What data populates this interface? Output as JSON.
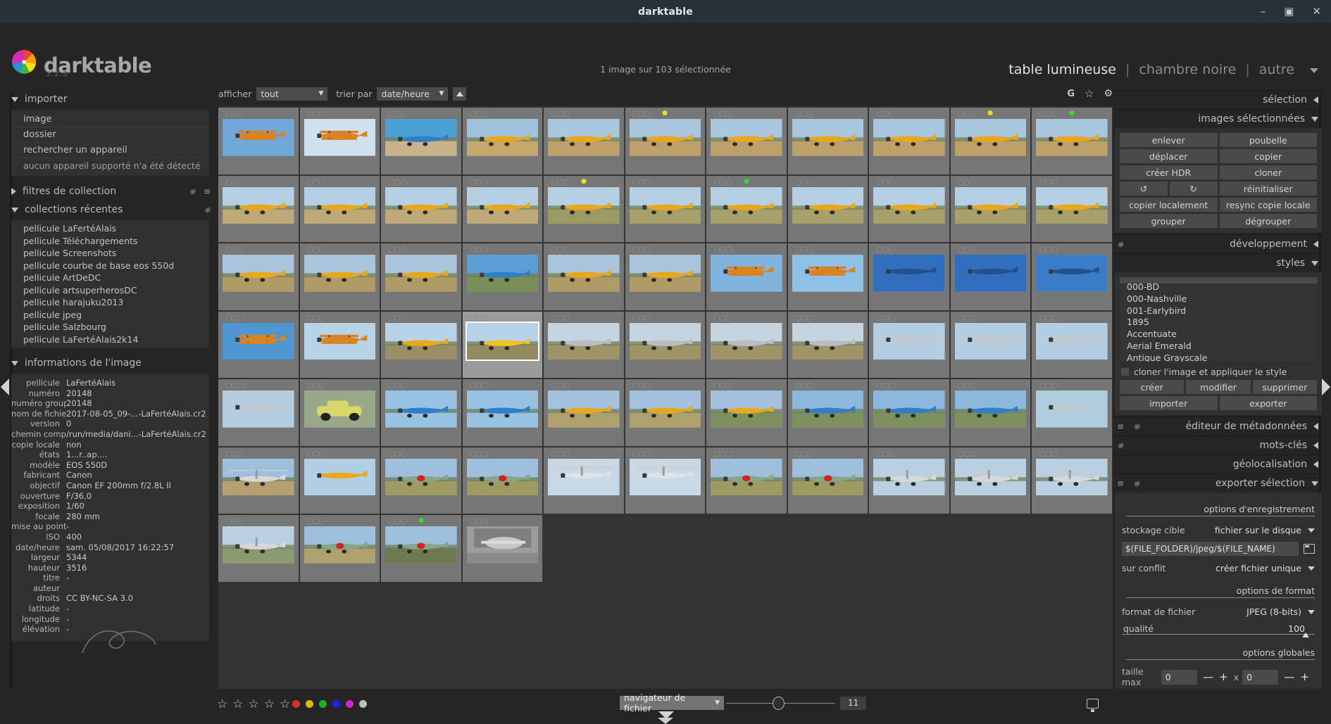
{
  "window": {
    "title": "darktable",
    "minimize": "—",
    "maximize": "▣",
    "close": "✕"
  },
  "header": {
    "app_name": "darktable",
    "version": "2.2.5",
    "selection_status": "1 image sur 103 sélectionnée",
    "views": [
      {
        "label": "table lumineuse",
        "active": true
      },
      {
        "label": "chambre noire",
        "active": false
      },
      {
        "label": "autre",
        "active": false
      }
    ]
  },
  "filterbar": {
    "show_label": "afficher",
    "show_value": "tout",
    "sort_label": "trier par",
    "sort_value": "date/heure",
    "icons": [
      "G",
      "star-icon",
      "gear-icon"
    ]
  },
  "left_panel": {
    "import": {
      "title": "importer",
      "items": [
        "image",
        "dossier",
        "rechercher un appareil",
        "aucun appareil supporté n'a été détecté"
      ]
    },
    "collection_filters": {
      "title": "filtres de collection"
    },
    "recent_collections": {
      "title": "collections récentes",
      "items": [
        "pellicule LaFertéAlais",
        "pellicule Téléchargements",
        "pellicule Screenshots",
        "pellicule courbe de base eos 550d",
        "pellicule ArtDeDC",
        "pellicule artsuperherosDC",
        "pellicule harajuku2013",
        "pellicule jpeg",
        "pellicule Salzbourg",
        "pellicule LaFertéAlais2k14"
      ]
    },
    "image_information": {
      "title": "informations de l'image",
      "rows": [
        {
          "key": "pellicule",
          "value": "LaFertéAlais"
        },
        {
          "key": "numéro",
          "value": "20148"
        },
        {
          "key": "numéro groupe",
          "value": "20148"
        },
        {
          "key": "nom de fichier",
          "value": "2017-08-05_09-...-LaFertéAlais.cr2"
        },
        {
          "key": "version",
          "value": "0"
        },
        {
          "key": "chemin complet",
          "value": "/run/media/dani...-LaFertéAlais.cr2"
        },
        {
          "key": "copie locale",
          "value": "non"
        },
        {
          "key": "états",
          "value": "1...r..ap...."
        },
        {
          "key": "modèle",
          "value": "EOS 550D"
        },
        {
          "key": "fabricant",
          "value": "Canon"
        },
        {
          "key": "objectif",
          "value": "Canon EF 200mm f/2.8L II"
        },
        {
          "key": "ouverture",
          "value": "F/36,0"
        },
        {
          "key": "exposition",
          "value": "1/60"
        },
        {
          "key": "focale",
          "value": "280 mm"
        },
        {
          "key": "mise au point",
          "value": "-"
        },
        {
          "key": "ISO",
          "value": "400"
        },
        {
          "key": "date/heure",
          "value": "sam. 05/08/2017 16:22:57"
        },
        {
          "key": "largeur",
          "value": "5344"
        },
        {
          "key": "hauteur",
          "value": "3516"
        },
        {
          "key": "titre",
          "value": "-"
        },
        {
          "key": "auteur",
          "value": ""
        },
        {
          "key": "droits",
          "value": "CC BY-NC-SA 3.0"
        },
        {
          "key": "latitude",
          "value": "-"
        },
        {
          "key": "longitude",
          "value": "-"
        },
        {
          "key": "élévation",
          "value": "-"
        }
      ]
    }
  },
  "right_panel": {
    "selection_title": "sélection",
    "selected_images": {
      "title": "images sélectionnées",
      "buttons": [
        "enlever",
        "poubelle",
        "déplacer",
        "copier",
        "créer HDR",
        "cloner"
      ],
      "rotate_ccw": "↺",
      "rotate_cw": "↻",
      "reset": "réinitialiser",
      "buttons2": [
        "copier localement",
        "resync copie locale",
        "grouper",
        "dégrouper"
      ]
    },
    "development_title": "développement",
    "styles": {
      "title": "styles",
      "items": [
        "000-BD",
        "000-Nashville",
        "001-Earlybird",
        "1895",
        "Accentuate",
        "Aerial Emerald",
        "Antique Grayscale"
      ],
      "clone_checkbox": "cloner l'image et appliquer le style",
      "actions": [
        "créer",
        "modifier",
        "supprimer"
      ],
      "io": [
        "importer",
        "exporter"
      ]
    },
    "metadata_title": "éditeur de métadonnées",
    "keywords_title": "mots-clés",
    "geotagging_title": "géolocalisation",
    "export": {
      "title": "exporter sélection",
      "storage_section": "options d'enregistrement",
      "target_label": "stockage cible",
      "target_value": "fichier sur le disque",
      "path_value": "$(FILE_FOLDER)/jpeg/$(FILE_NAME)",
      "conflict_label": "sur conflit",
      "conflict_value": "créer fichier unique",
      "format_section": "options de format",
      "format_label": "format de fichier",
      "format_value": "JPEG (8-bits)",
      "quality_label": "qualité",
      "quality_value": "100",
      "global_section": "options globales",
      "maxsize_label": "taille max",
      "maxsize_w": "0",
      "maxsize_h": "0",
      "minus": "—",
      "plus": "+",
      "times": "x"
    }
  },
  "bottom_bar": {
    "stars": [
      "☆",
      "☆",
      "☆",
      "☆",
      "☆"
    ],
    "color_labels": [
      "#d93025",
      "#d4bb19",
      "#22b126",
      "#2222e0",
      "#d61fd6",
      "#bdbdbd"
    ],
    "zoom_mode": "navigateur de fichier",
    "zoom_value": "11"
  },
  "grid": {
    "columns": 11,
    "rows": [
      [
        {
          "sky": "#6fa8d8",
          "ground": "#7d9ac0",
          "kind": "biplane-air",
          "dot": null
        },
        {
          "sky": "#cfe0ee",
          "ground": "#cfe0ee",
          "kind": "biplane-air2",
          "dot": null
        },
        {
          "sky": "#4a9fd4",
          "ground": "#c8b38c",
          "kind": "blue-plane",
          "dot": null
        },
        {
          "sky": "#9fc3dd",
          "ground": "#c4a86c",
          "kind": "yellow-taxi",
          "dot": null
        },
        {
          "sky": "#a8c6dd",
          "ground": "#bda06a",
          "kind": "yellow-taxi",
          "dot": null
        },
        {
          "sky": "#a8c6dd",
          "ground": "#bda06a",
          "kind": "yellow-taxi",
          "dot": "#e8e020"
        },
        {
          "sky": "#a8c6dd",
          "ground": "#bda06a",
          "kind": "yellow-taxi",
          "dot": null
        },
        {
          "sky": "#a8c6dd",
          "ground": "#bda06a",
          "kind": "yellow-taxi",
          "dot": null
        },
        {
          "sky": "#a8c6dd",
          "ground": "#bda06a",
          "kind": "yellow-taxi",
          "dot": null
        },
        {
          "sky": "#a8c6dd",
          "ground": "#bda06a",
          "kind": "yellow-taxi",
          "dot": "#e8e020"
        },
        {
          "sky": "#a8c6dd",
          "ground": "#bda06a",
          "kind": "yellow-taxi",
          "dot": "#2ee02e"
        }
      ],
      [
        {
          "sky": "#b7cfe2",
          "ground": "#c0a978",
          "kind": "yellow-taxi",
          "dot": null
        },
        {
          "sky": "#b7cfe2",
          "ground": "#c0a978",
          "kind": "yellow-taxi",
          "dot": null
        },
        {
          "sky": "#b7cfe2",
          "ground": "#c0a978",
          "kind": "yellow-taxi",
          "dot": null
        },
        {
          "sky": "#b7cfe2",
          "ground": "#c0a978",
          "kind": "yellow-taxi",
          "dot": null
        },
        {
          "sky": "#b7cfe2",
          "ground": "#9d9b64",
          "kind": "yellow-taxi",
          "dot": "#e8e020"
        },
        {
          "sky": "#b7cfe2",
          "ground": "#a8a06a",
          "kind": "yellow-taxi",
          "dot": null
        },
        {
          "sky": "#b7cfe2",
          "ground": "#a8a06a",
          "kind": "yellow-taxi",
          "dot": "#2ee02e"
        },
        {
          "sky": "#b7cfe2",
          "ground": "#a8a06a",
          "kind": "yellow-taxi",
          "dot": null
        },
        {
          "sky": "#b7cfe2",
          "ground": "#a8a06a",
          "kind": "yellow-taxi",
          "dot": null
        },
        {
          "sky": "#b7cfe2",
          "ground": "#a8a06a",
          "kind": "yellow-taxi",
          "dot": null
        },
        {
          "sky": "#b7cfe2",
          "ground": "#a8a06a",
          "kind": "yellow-taxi",
          "dot": null
        }
      ],
      [
        {
          "sky": "#aac4dc",
          "ground": "#b09b68",
          "kind": "yellow-taxi",
          "dot": null
        },
        {
          "sky": "#aac4dc",
          "ground": "#b09b68",
          "kind": "yellow-taxi",
          "dot": null
        },
        {
          "sky": "#aac4dc",
          "ground": "#b09b68",
          "kind": "yellow-taxi",
          "dot": null
        },
        {
          "sky": "#5c9ed6",
          "ground": "#7a8f5a",
          "kind": "blue-plane",
          "dot": null
        },
        {
          "sky": "#aac4dc",
          "ground": "#b09b68",
          "kind": "yellow-taxi",
          "dot": null
        },
        {
          "sky": "#aac4dc",
          "ground": "#b09b68",
          "kind": "yellow-taxi",
          "dot": null
        },
        {
          "sky": "#7fb4de",
          "ground": "#7fb4de",
          "kind": "biplane-air",
          "dot": null
        },
        {
          "sky": "#8fc0e6",
          "ground": "#8fc0e6",
          "kind": "biplane-air2",
          "dot": null
        },
        {
          "sky": "#2f6fbe",
          "ground": "#2f6fbe",
          "kind": "darkblue-air",
          "dot": null
        },
        {
          "sky": "#2f6fbe",
          "ground": "#2f6fbe",
          "kind": "darkblue-air",
          "dot": null
        },
        {
          "sky": "#3a7cc6",
          "ground": "#3a7cc6",
          "kind": "darkblue-air",
          "dot": null
        }
      ],
      [
        {
          "sky": "#4e96d2",
          "ground": "#4e96d2",
          "kind": "biplane-air",
          "dot": null
        },
        {
          "sky": "#b9d2e6",
          "ground": "#b9d2e6",
          "kind": "biplane-air2",
          "dot": null
        },
        {
          "sky": "#b9d2e6",
          "ground": "#9a8f64",
          "kind": "yellow-taxi",
          "dot": null
        },
        {
          "sky": "#b9d2e6",
          "ground": "#948a60",
          "kind": "yellow-warbird",
          "dot": null,
          "selected": true
        },
        {
          "sky": "#c6d4e0",
          "ground": "#9e9468",
          "kind": "silver-plane",
          "dot": null
        },
        {
          "sky": "#c6d4e0",
          "ground": "#9e9468",
          "kind": "silver-plane",
          "dot": null
        },
        {
          "sky": "#c6d4e0",
          "ground": "#9e9468",
          "kind": "silver-plane",
          "dot": null
        },
        {
          "sky": "#c6d4e0",
          "ground": "#9e9468",
          "kind": "silver-plane",
          "dot": null
        },
        {
          "sky": "#b5cde0",
          "ground": "#b5cde0",
          "kind": "silver-air",
          "dot": null
        },
        {
          "sky": "#b5cde0",
          "ground": "#b5cde0",
          "kind": "silver-air",
          "dot": null
        },
        {
          "sky": "#b5cde0",
          "ground": "#b5cde0",
          "kind": "silver-air",
          "dot": null
        }
      ],
      [
        {
          "sky": "#b5cde0",
          "ground": "#b5cde0",
          "kind": "silver-air",
          "dot": null
        },
        {
          "sky": "#9aa88a",
          "ground": "#9aa88a",
          "kind": "car",
          "dot": null
        },
        {
          "sky": "#98c2e2",
          "ground": "#98c2e2",
          "kind": "blue-plane",
          "dot": null
        },
        {
          "sky": "#98c2e2",
          "ground": "#98c2e2",
          "kind": "blue-plane",
          "dot": null
        },
        {
          "sky": "#a4c2dd",
          "ground": "#b0a070",
          "kind": "yellow-taxi",
          "dot": null
        },
        {
          "sky": "#a4c2dd",
          "ground": "#b0a070",
          "kind": "yellow-taxi",
          "dot": null
        },
        {
          "sky": "#a4c2dd",
          "ground": "#7f9060",
          "kind": "yellow-taxi",
          "dot": null
        },
        {
          "sky": "#8cb8dd",
          "ground": "#7f9060",
          "kind": "blue-plane",
          "dot": null
        },
        {
          "sky": "#8cb8dd",
          "ground": "#7f9060",
          "kind": "blue-plane",
          "dot": null
        },
        {
          "sky": "#8cb8dd",
          "ground": "#7f9060",
          "kind": "blue-plane",
          "dot": null
        },
        {
          "sky": "#b0cde0",
          "ground": "#7f9060",
          "kind": "silver-air",
          "dot": null
        }
      ],
      [
        {
          "sky": "#9fc0dc",
          "ground": "#b5a070",
          "kind": "heli",
          "dot": null
        },
        {
          "sky": "#b0cfe4",
          "ground": "#c0a878",
          "kind": "yellow-air",
          "dot": null
        },
        {
          "sky": "#9ec0dc",
          "ground": "#9d9a62",
          "kind": "green-plane",
          "dot": null
        },
        {
          "sky": "#9ec0dc",
          "ground": "#9d9a62",
          "kind": "green-plane",
          "dot": null
        },
        {
          "sky": "#c8d8e4",
          "ground": "#8a9a70",
          "kind": "heli-blur",
          "dot": null
        },
        {
          "sky": "#c8d8e4",
          "ground": "#8a9a70",
          "kind": "heli-blur",
          "dot": null
        },
        {
          "sky": "#9ec0dc",
          "ground": "#9d9a62",
          "kind": "green-plane",
          "dot": null
        },
        {
          "sky": "#9ec0dc",
          "ground": "#9d9a62",
          "kind": "green-plane",
          "dot": null
        },
        {
          "sky": "#b8d0e2",
          "ground": "#b8d0e2",
          "kind": "heli",
          "dot": null
        },
        {
          "sky": "#b8d0e2",
          "ground": "#b8d0e2",
          "kind": "heli",
          "dot": null
        },
        {
          "sky": "#b8d0e2",
          "ground": "#b8d0e2",
          "kind": "heli",
          "dot": null
        }
      ],
      [
        {
          "sky": "#b8d0e2",
          "ground": "#8a9a70",
          "kind": "heli",
          "dot": null
        },
        {
          "sky": "#9ec0dc",
          "ground": "#b0a070",
          "kind": "green-plane",
          "dot": null
        },
        {
          "sky": "#9ec0dc",
          "ground": "#6d7a50",
          "kind": "green-plane",
          "dot": "#2ee02e"
        },
        {
          "sky": "#9c9c9c",
          "ground": "#8a8a8a",
          "kind": "bw-plane",
          "dot": null
        }
      ]
    ]
  }
}
